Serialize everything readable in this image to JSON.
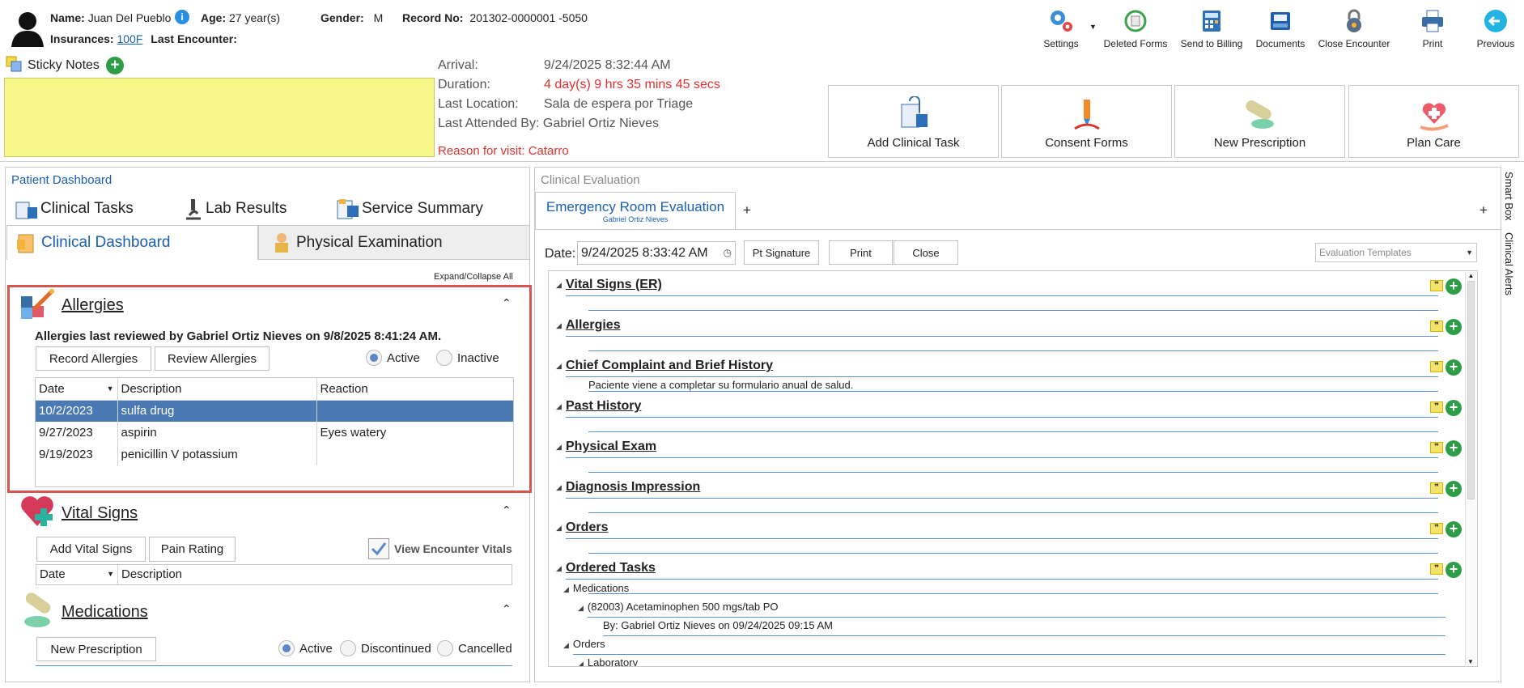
{
  "patient": {
    "name_label": "Name:",
    "name": "Juan Del Pueblo",
    "age_label": "Age:",
    "age": "27 year(s)",
    "gender_label": "Gender:",
    "gender": "M",
    "record_label": "Record No:",
    "record": "201302-0000001 -5050",
    "insurances_label": "Insurances:",
    "insurance": "100F",
    "last_encounter_label": "Last Encounter:"
  },
  "toolbar": {
    "settings": "Settings",
    "deleted_forms": "Deleted Forms",
    "send_billing": "Send to Billing",
    "documents": "Documents",
    "close_encounter": "Close Encounter",
    "print": "Print",
    "previous": "Previous"
  },
  "sticky": {
    "label": "Sticky Notes"
  },
  "visit": {
    "arrival_label": "Arrival:",
    "arrival": "9/24/2025 8:32:44 AM",
    "duration_label": "Duration:",
    "duration": "4 day(s) 9 hrs 35 mins 45 secs",
    "last_location_label": "Last Location:",
    "last_location": "Sala de espera por Triage",
    "last_attended_label": "Last Attended By:",
    "last_attended": "Gabriel Ortiz Nieves",
    "reason": "Reason for visit: Catarro"
  },
  "actions": {
    "add_clinical_task": "Add Clinical Task",
    "consent_forms": "Consent Forms",
    "new_prescription": "New Prescription",
    "plan_care": "Plan Care"
  },
  "dashboard": {
    "title": "Patient Dashboard",
    "tabs": {
      "clinical_tasks": "Clinical Tasks",
      "lab_results": "Lab Results",
      "service_summary": "Service Summary",
      "clinical_dashboard": "Clinical Dashboard",
      "physical_exam": "Physical Examination"
    },
    "expand_collapse": "Expand/Collapse All",
    "allergies": {
      "title": "Allergies",
      "reviewed": "Allergies last reviewed by Gabriel Ortiz Nieves on 9/8/2025 8:41:24 AM.",
      "record_btn": "Record Allergies",
      "review_btn": "Review Allergies",
      "active": "Active",
      "inactive": "Inactive",
      "columns": [
        "Date",
        "Description",
        "Reaction"
      ],
      "rows": [
        {
          "date": "10/2/2023",
          "description": "sulfa drug",
          "reaction": ""
        },
        {
          "date": "9/27/2023",
          "description": "aspirin",
          "reaction": "Eyes watery"
        },
        {
          "date": "9/19/2023",
          "description": "penicillin V potassium",
          "reaction": ""
        }
      ]
    },
    "vitals": {
      "title": "Vital Signs",
      "add_btn": "Add Vital Signs",
      "pain_btn": "Pain Rating",
      "view_encounter": "View Encounter Vitals",
      "columns": [
        "Date",
        "Description"
      ]
    },
    "medications": {
      "title": "Medications",
      "new_btn": "New Prescription",
      "active": "Active",
      "discontinued": "Discontinued",
      "cancelled": "Cancelled"
    }
  },
  "evaluation": {
    "title": "Clinical Evaluation",
    "tab": "Emergency Room Evaluation",
    "tab_sub": "Gabriel Ortiz Nieves",
    "plus": "+",
    "date_label": "Date:",
    "date": "9/24/2025 8:33:42 AM",
    "pt_signature": "Pt Signature",
    "print": "Print",
    "close": "Close",
    "templates": "Evaluation Templates",
    "sections": [
      {
        "title": "Vital Signs (ER)",
        "note": ""
      },
      {
        "title": "Allergies",
        "note": ""
      },
      {
        "title": "Chief Complaint and Brief History",
        "note": "Paciente viene a completar su formulario anual de salud."
      },
      {
        "title": "Past History",
        "note": ""
      },
      {
        "title": "Physical Exam",
        "note": ""
      },
      {
        "title": "Diagnosis Impression",
        "note": ""
      },
      {
        "title": "Orders",
        "note": ""
      },
      {
        "title": "Ordered Tasks",
        "note": ""
      }
    ],
    "tree": {
      "medications": "Medications",
      "med_item": "(82003) Acetaminophen 500 mgs/tab PO",
      "med_by": "By: Gabriel Ortiz Nieves on 09/24/2025 09:15 AM",
      "orders": "Orders",
      "laboratory": "Laboratory"
    }
  },
  "side": {
    "smart_box": "Smart Box",
    "clinical_alerts": "Clinical Alerts"
  }
}
